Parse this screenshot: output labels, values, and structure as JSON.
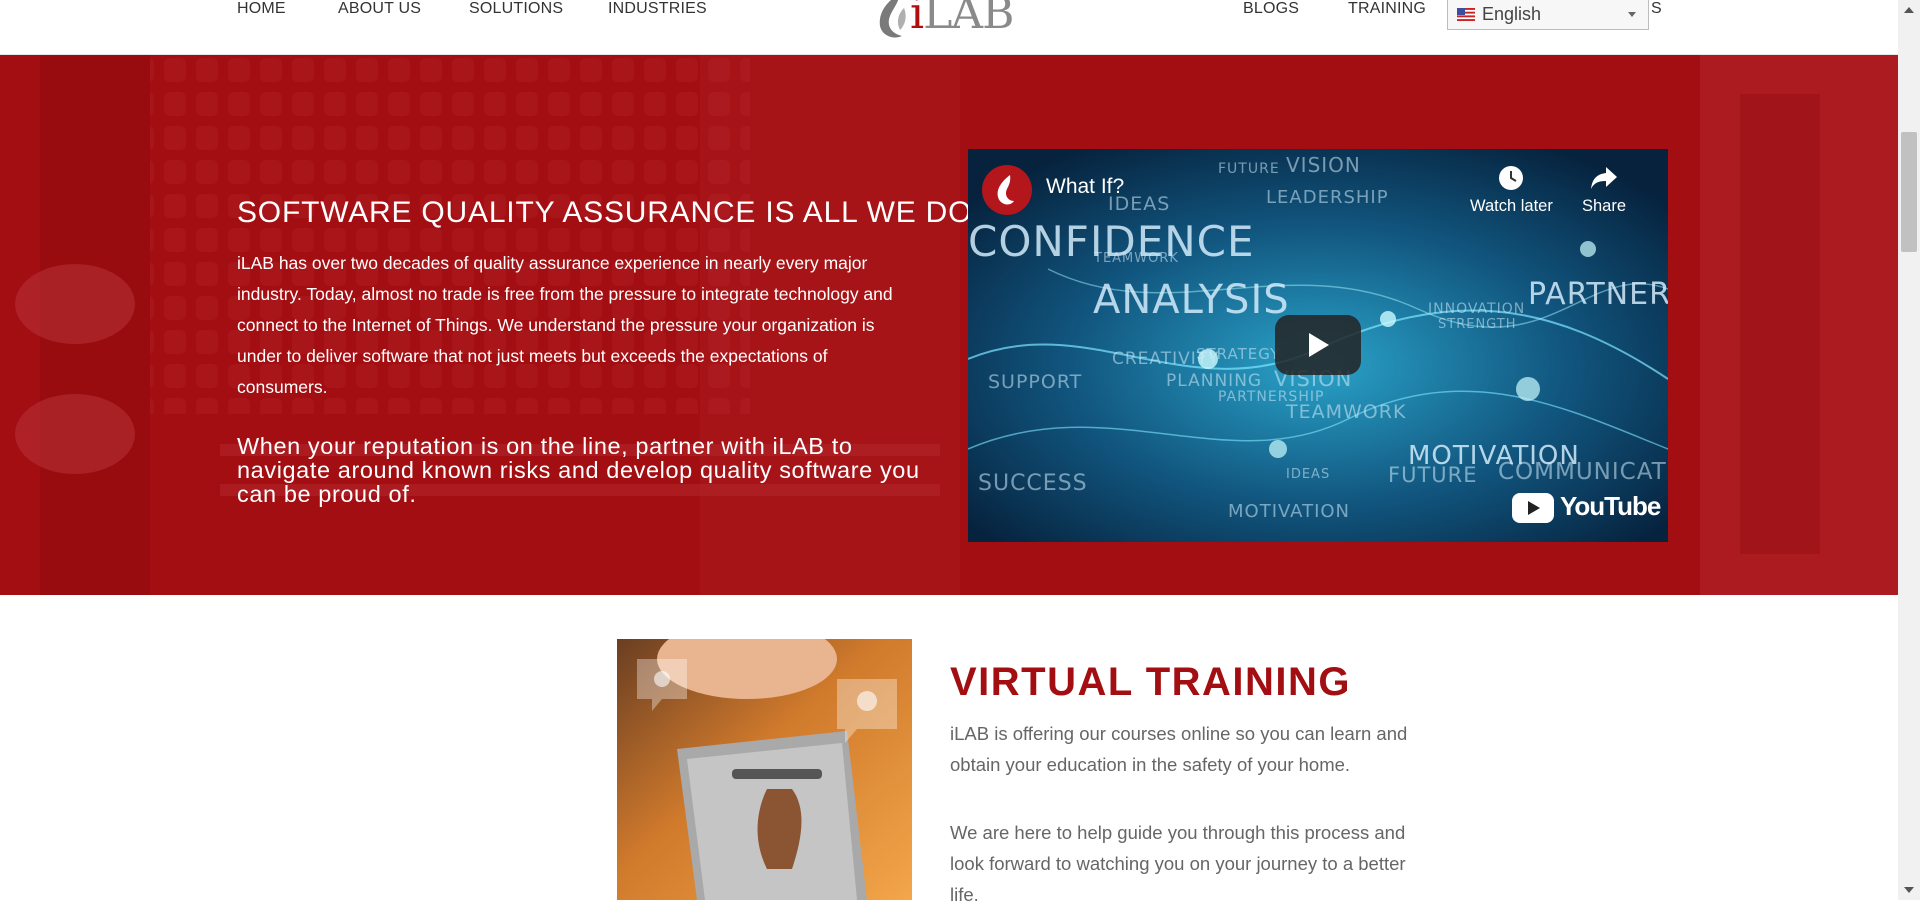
{
  "header": {
    "nav_left": [
      "HOME",
      "ABOUT US",
      "SOLUTIONS",
      "INDUSTRIES"
    ],
    "nav_right": [
      "BLOGS",
      "TRAINING"
    ],
    "nav_right_clipped": "S",
    "logo_text_i": "i",
    "logo_text_rest": "LAB",
    "language": "English",
    "brand_color": "#b00d0d"
  },
  "hero": {
    "heading": "SOFTWARE QUALITY ASSURANCE IS ALL WE DO.",
    "body": "iLAB has over two decades of quality assurance experience in nearly every major industry. Today, almost no trade is free from the pressure to integrate technology and connect to the Internet of Things. We understand the pressure your organization is under to deliver software that not just meets but exceeds the expectations of consumers.",
    "lead": "When your reputation is on the line, partner with iLAB to navigate around known risks and develop quality software you can be proud of.",
    "background_color": "#a30e12"
  },
  "video": {
    "title": "What If?",
    "watch_later": "Watch later",
    "share": "Share",
    "platform": "YouTube",
    "words": [
      "FUTURE",
      "VISION",
      "LEADERSHIP",
      "IDEAS",
      "CONFIDENCE",
      "TEAMWORK",
      "ANALYSIS",
      "PARTNER",
      "STRENGTH",
      "INNOVATION",
      "CREATIVITY",
      "STRATEGY",
      "SUPPORT",
      "PLANNING",
      "VISION",
      "PARTNERSHIP",
      "TEAMWORK",
      "MOTIVATION",
      "COMMUNICATION",
      "SUCCESS",
      "IDEAS",
      "FUTURE",
      "MOTIVATION"
    ]
  },
  "training": {
    "title": "VIRTUAL TRAINING",
    "p1": "iLAB is offering our courses online so you can learn and obtain your education in the safety of your home.",
    "p2": "We are here to help guide you through this process and look forward to watching you on your journey to a better life."
  }
}
